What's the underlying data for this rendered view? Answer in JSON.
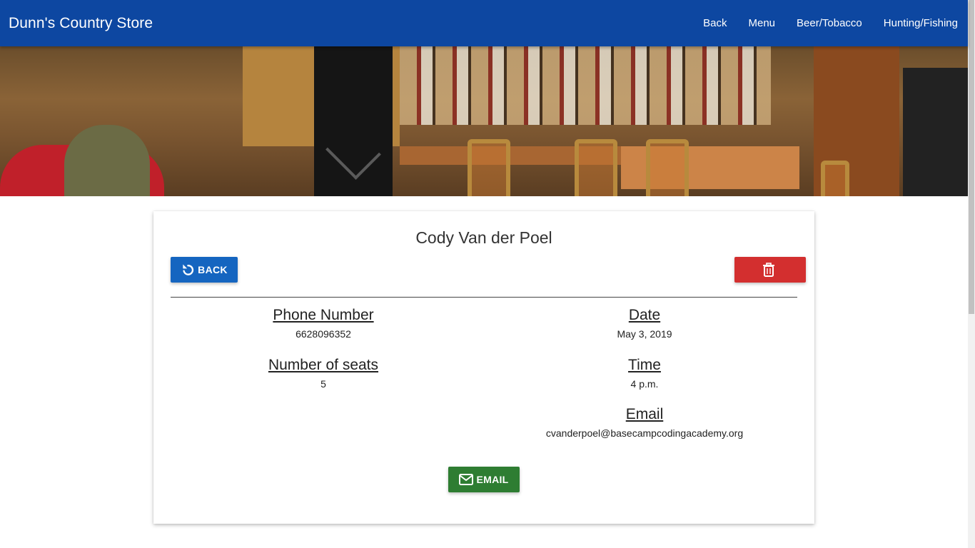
{
  "navbar": {
    "brand": "Dunn's Country Store",
    "links": [
      "Back",
      "Menu",
      "Beer/Tobacco",
      "Hunting/Fishing"
    ]
  },
  "card": {
    "title": "Cody Van der Poel",
    "back_label": "BACK",
    "email_label": "EMAIL",
    "delete_icon": "trash-icon",
    "fields": {
      "phone": {
        "label": "Phone Number",
        "value": "6628096352"
      },
      "seats": {
        "label": "Number of seats",
        "value": "5"
      },
      "date": {
        "label": "Date",
        "value": "May 3, 2019"
      },
      "time": {
        "label": "Time",
        "value": "4 p.m."
      },
      "email": {
        "label": "Email",
        "value": "cvanderpoel@basecampcodingacademy.org"
      }
    }
  },
  "colors": {
    "navbar": "#0d47a1",
    "back_button": "#1565c0",
    "delete_button": "#d32f2f",
    "email_button": "#2e7d32"
  }
}
